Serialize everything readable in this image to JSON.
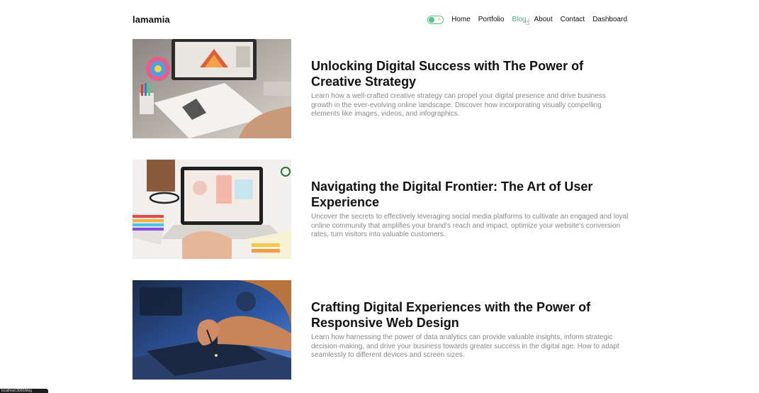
{
  "header": {
    "logo": "lamamia",
    "nav": [
      {
        "label": "Home"
      },
      {
        "label": "Portfolio"
      },
      {
        "label": "Blog"
      },
      {
        "label": "About"
      },
      {
        "label": "Contact"
      },
      {
        "label": "Dashboard"
      }
    ],
    "toggle": {
      "sun": "☀"
    }
  },
  "posts": [
    {
      "title": "Unlocking Digital Success with The Power of Creative Strategy",
      "description": "Learn how a well-crafted creative strategy can propel your digital presence and drive business growth in the ever-evolving online landscape. Discover how incorporating visually compelling elements like images, videos, and infographics."
    },
    {
      "title": "Navigating the Digital Frontier: The Art of User Experience",
      "description": "Uncover the secrets to effectively leveraging social media platforms to cultivate an engaged and loyal online community that amplifies your brand's reach and impact. optimize your website's conversion rates, turn visitors into valuable customers."
    },
    {
      "title": "Crafting Digital Experiences with the Power of Responsive Web Design",
      "description": "Learn how harnessing the power of data analytics can provide valuable insights, inform strategic decision-making, and drive your business towards greater success in the digital age. How to adapt seamlessly to different devices and screen sizes."
    }
  ],
  "status_bar": {
    "text": "localhost:3000/blog"
  },
  "colors": {
    "accent": "#53c28b",
    "active_link": "#53a88b",
    "description_text": "#8a8a8a"
  }
}
